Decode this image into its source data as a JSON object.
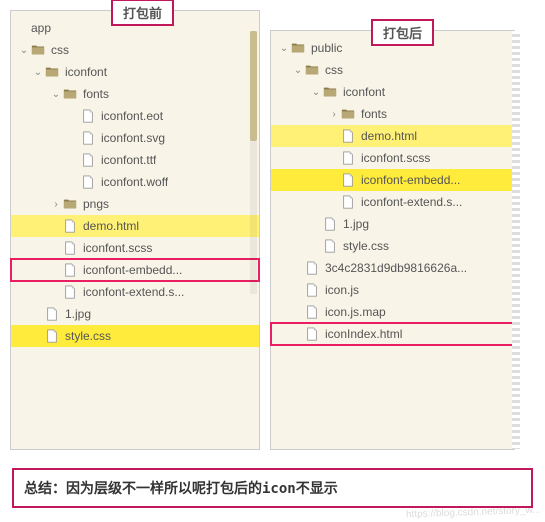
{
  "labels": {
    "before": "打包前",
    "after": "打包后"
  },
  "summary": "总结：因为层级不一样所以呢打包后的icon不显示",
  "watermark": "https://blog.csdn.net/story_w...",
  "left_tree": [
    {
      "name": "app",
      "type": "text",
      "depth": 0
    },
    {
      "name": "css",
      "type": "folder",
      "depth": 0,
      "open": true
    },
    {
      "name": "iconfont",
      "type": "folder",
      "depth": 1,
      "open": true
    },
    {
      "name": "fonts",
      "type": "folder",
      "depth": 2,
      "open": true
    },
    {
      "name": "iconfont.eot",
      "type": "file",
      "depth": 3
    },
    {
      "name": "iconfont.svg",
      "type": "file",
      "depth": 3
    },
    {
      "name": "iconfont.ttf",
      "type": "file",
      "depth": 3
    },
    {
      "name": "iconfont.woff",
      "type": "file",
      "depth": 3
    },
    {
      "name": "pngs",
      "type": "folder",
      "depth": 2,
      "open": false
    },
    {
      "name": "demo.html",
      "type": "file",
      "depth": 2,
      "hl": "yellow"
    },
    {
      "name": "iconfont.scss",
      "type": "file",
      "depth": 2
    },
    {
      "name": "iconfont-embedd...",
      "type": "file",
      "depth": 2,
      "box": true
    },
    {
      "name": "iconfont-extend.s...",
      "type": "file",
      "depth": 2
    },
    {
      "name": "1.jpg",
      "type": "file",
      "depth": 1
    },
    {
      "name": "style.css",
      "type": "file",
      "depth": 1,
      "hl": "yellow2"
    }
  ],
  "right_tree": [
    {
      "name": "public",
      "type": "folder",
      "depth": 0,
      "open": true
    },
    {
      "name": "css",
      "type": "folder",
      "depth": 1,
      "open": true
    },
    {
      "name": "iconfont",
      "type": "folder",
      "depth": 2,
      "open": true
    },
    {
      "name": "fonts",
      "type": "folder",
      "depth": 3,
      "open": false
    },
    {
      "name": "demo.html",
      "type": "file",
      "depth": 3,
      "hl": "yellow"
    },
    {
      "name": "iconfont.scss",
      "type": "file",
      "depth": 3
    },
    {
      "name": "iconfont-embedd...",
      "type": "file",
      "depth": 3,
      "hl": "yellow2"
    },
    {
      "name": "iconfont-extend.s...",
      "type": "file",
      "depth": 3
    },
    {
      "name": "1.jpg",
      "type": "file",
      "depth": 2
    },
    {
      "name": "style.css",
      "type": "file",
      "depth": 2
    },
    {
      "name": "3c4c2831d9db9816626a...",
      "type": "file",
      "depth": 1
    },
    {
      "name": "icon.js",
      "type": "file",
      "depth": 1
    },
    {
      "name": "icon.js.map",
      "type": "file",
      "depth": 1
    },
    {
      "name": "iconIndex.html",
      "type": "file",
      "depth": 1,
      "box": true
    }
  ]
}
